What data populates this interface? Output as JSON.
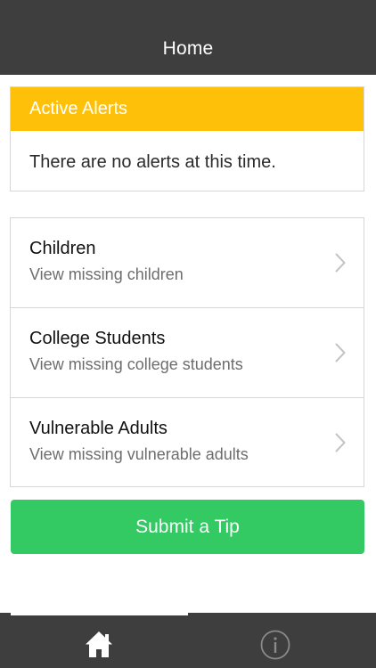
{
  "header": {
    "title": "Home"
  },
  "alerts": {
    "header_label": "Active Alerts",
    "message": "There are no alerts at this time.",
    "header_color": "#fec009"
  },
  "categories": [
    {
      "title": "Children",
      "subtitle": "View missing children",
      "icon": "chevron-right-icon"
    },
    {
      "title": "College Students",
      "subtitle": "View missing college students",
      "icon": "chevron-right-icon"
    },
    {
      "title": "Vulnerable Adults",
      "subtitle": "View missing vulnerable adults",
      "icon": "chevron-right-icon"
    }
  ],
  "tip_button": {
    "label": "Submit a Tip",
    "color": "#33c963"
  },
  "tabbar": {
    "tabs": [
      {
        "icon": "home-icon",
        "active": true
      },
      {
        "icon": "info-icon",
        "active": false
      }
    ],
    "background": "#3e3e3e"
  }
}
